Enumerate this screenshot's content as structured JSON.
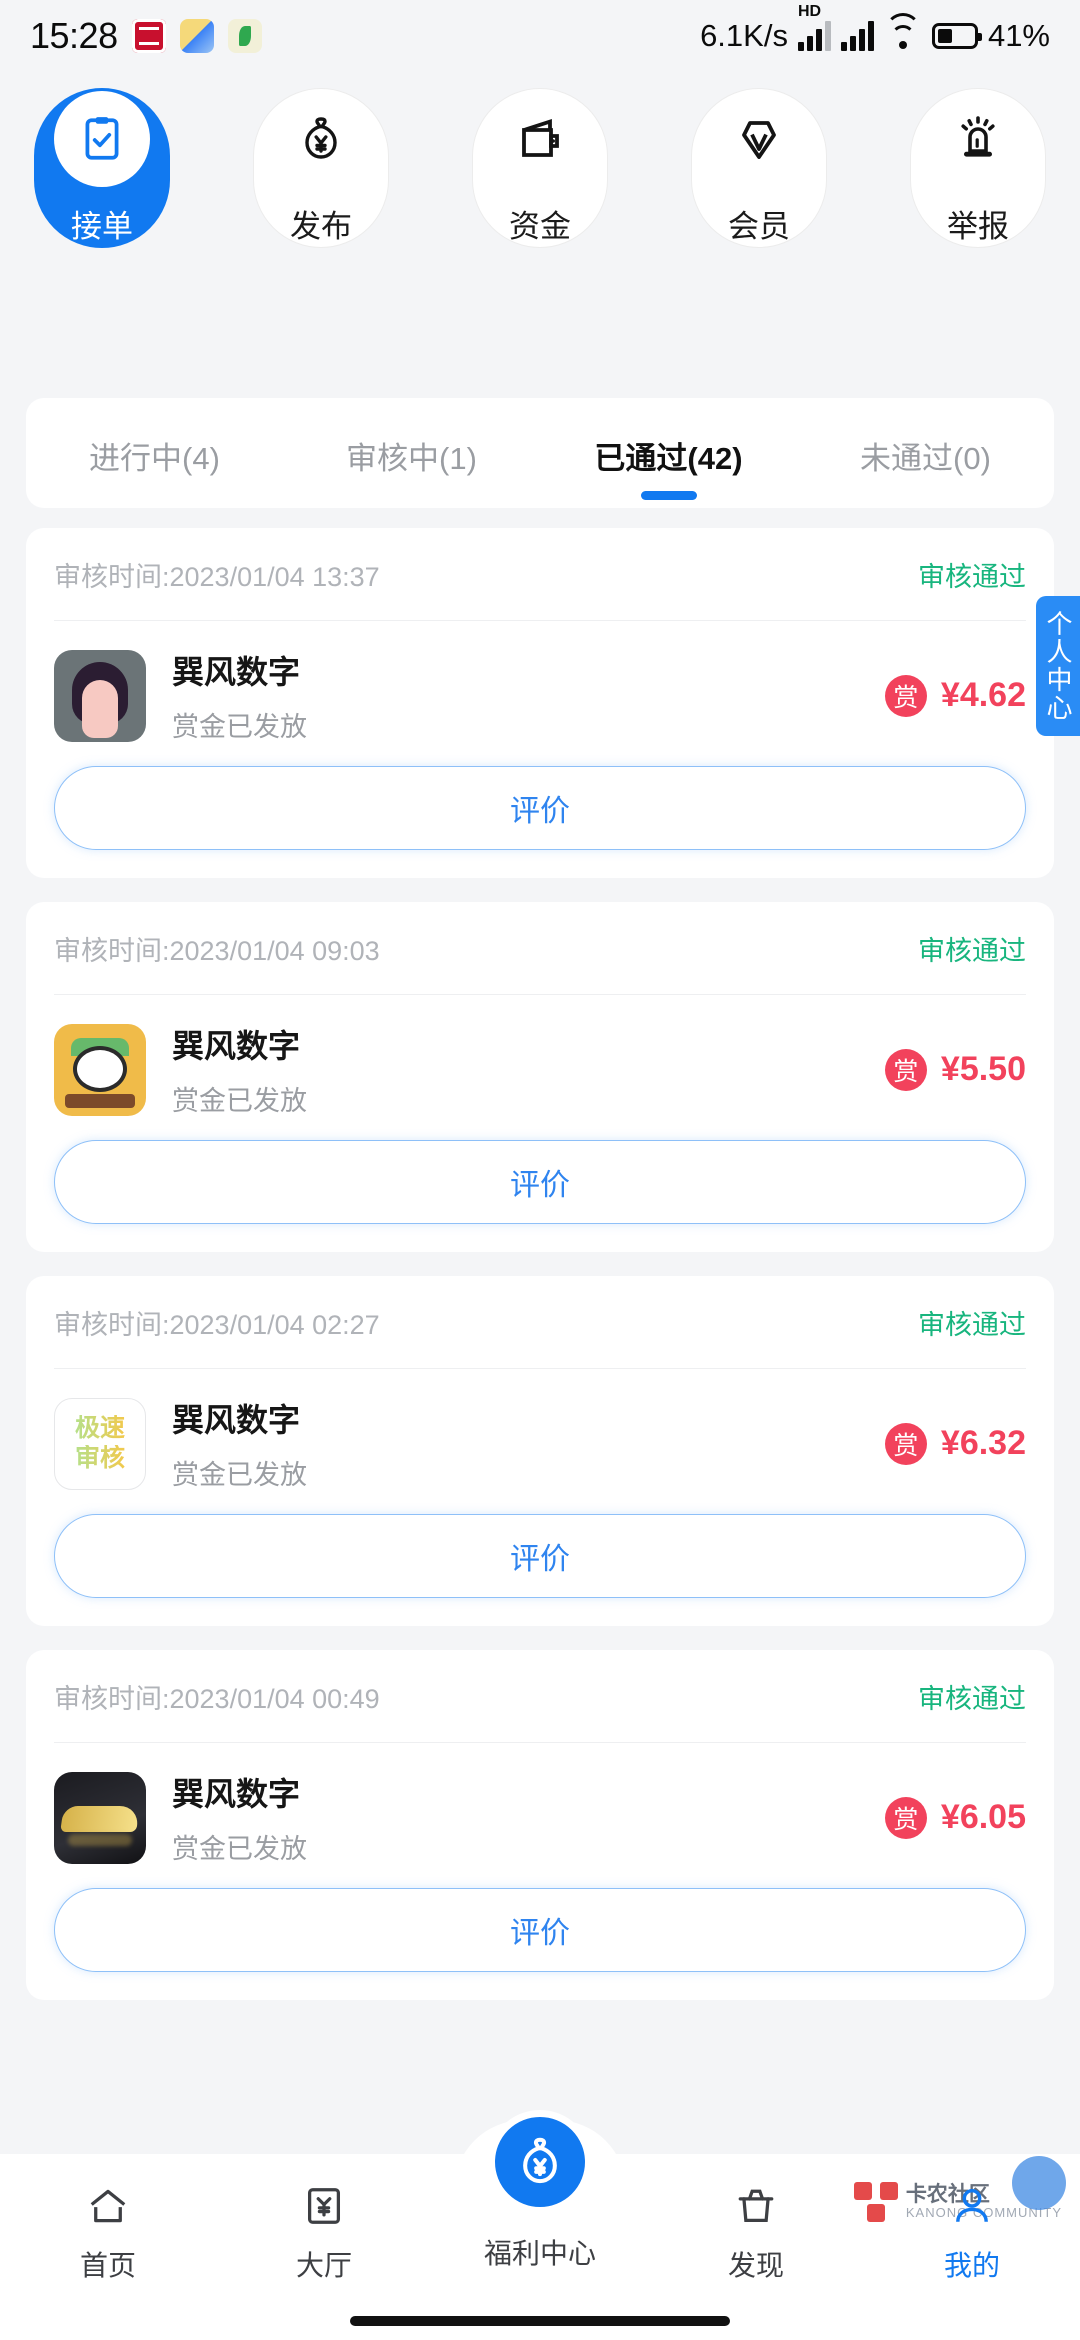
{
  "statusbar": {
    "time": "15:28",
    "net_speed": "6.1K/s",
    "hd": "HD",
    "battery_pct": "41%",
    "icons": [
      "car-brand-icon",
      "navigation-plane-icon",
      "leaf-app-icon",
      "signal-bars-icon",
      "signal-bars-icon-2",
      "wifi-icon",
      "battery-icon"
    ]
  },
  "categories": [
    {
      "label": "接单",
      "icon": "clipboard-check-icon",
      "active": true
    },
    {
      "label": "发布",
      "icon": "money-bag-icon",
      "active": false
    },
    {
      "label": "资金",
      "icon": "wallet-icon",
      "active": false
    },
    {
      "label": "会员",
      "icon": "diamond-icon",
      "active": false
    },
    {
      "label": "举报",
      "icon": "alarm-siren-icon",
      "active": false
    }
  ],
  "tabs": [
    {
      "label": "进行中(4)",
      "active": false
    },
    {
      "label": "审核中(1)",
      "active": false
    },
    {
      "label": "已通过(42)",
      "active": true
    },
    {
      "label": "未通过(0)",
      "active": false
    }
  ],
  "side_tab": {
    "label": "个人中心"
  },
  "orders": [
    {
      "time_label": "审核时间:2023/01/04 13:37",
      "status": "审核通过",
      "title": "巽风数字",
      "subtitle": "赏金已发放",
      "badge": "赏",
      "amount": "¥4.62",
      "action": "评价",
      "avatar": "person-avatar"
    },
    {
      "time_label": "审核时间:2023/01/04 09:03",
      "status": "审核通过",
      "title": "巽风数字",
      "subtitle": "赏金已发放",
      "badge": "赏",
      "amount": "¥5.50",
      "action": "评价",
      "avatar": "duck-avatar"
    },
    {
      "time_label": "审核时间:2023/01/04 02:27",
      "status": "审核通过",
      "title": "巽风数字",
      "subtitle": "赏金已发放",
      "badge": "赏",
      "amount": "¥6.32",
      "action": "评价",
      "avatar": "fast-review-avatar",
      "avatar_text_1": "极速",
      "avatar_text_2": "审核"
    },
    {
      "time_label": "审核时间:2023/01/04 00:49",
      "status": "审核通过",
      "title": "巽风数字",
      "subtitle": "赏金已发放",
      "badge": "赏",
      "amount": "¥6.05",
      "action": "评价",
      "avatar": "car-avatar"
    }
  ],
  "bottom_nav": [
    {
      "label": "首页",
      "icon": "home-icon",
      "active": false
    },
    {
      "label": "大厅",
      "icon": "hall-ticket-icon",
      "active": false
    },
    {
      "label": "福利中心",
      "icon": "money-bag-icon",
      "active": false,
      "fab": true
    },
    {
      "label": "发现",
      "icon": "discover-basket-icon",
      "active": false
    },
    {
      "label": "我的",
      "icon": "user-profile-icon",
      "active": true
    }
  ],
  "watermark": {
    "line1": "卡农社区",
    "line2": "KANONG COMMUNITY"
  },
  "colors": {
    "accent_blue": "#1179f0",
    "success_green": "#18b57e",
    "price_red": "#f2425c",
    "page_bg": "#f4f5f7",
    "card_bg": "#ffffff",
    "muted_text": "#9a9da2"
  }
}
